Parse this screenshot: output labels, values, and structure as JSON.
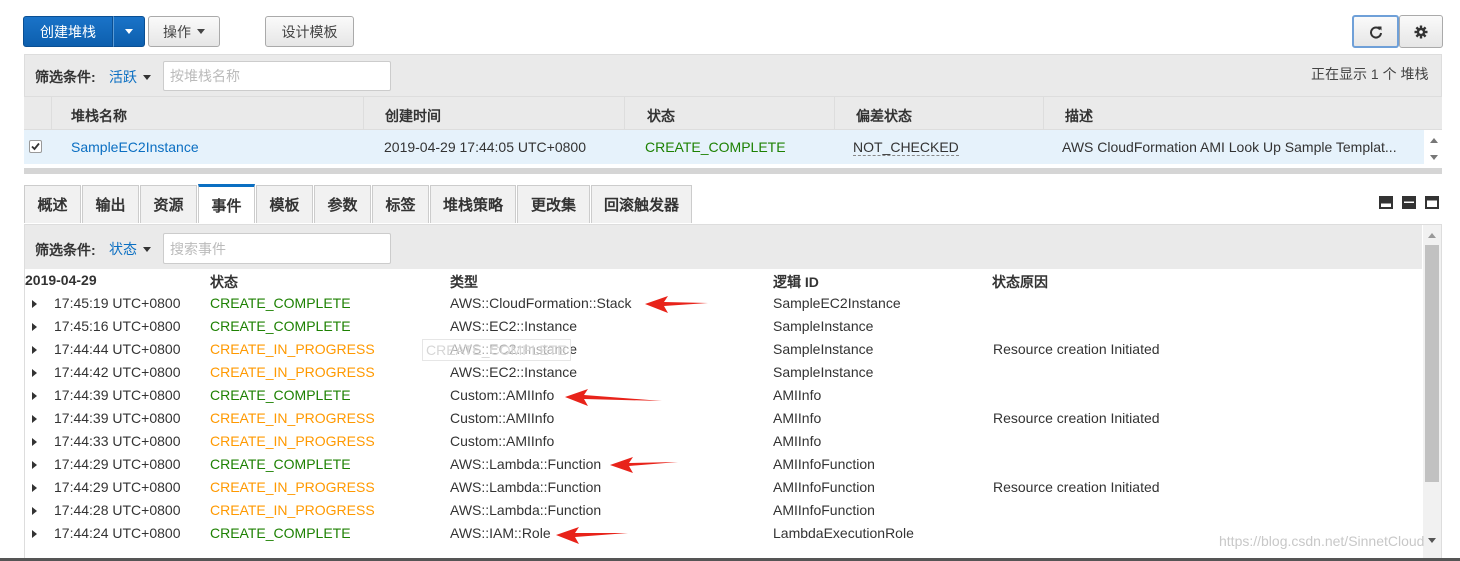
{
  "toolbar": {
    "create_stack": "创建堆栈",
    "actions": "操作",
    "design_template": "设计模板"
  },
  "stack_filter": {
    "label": "筛选条件:",
    "value": "活跃",
    "placeholder": "按堆栈名称",
    "showing": "正在显示 1 个 堆栈"
  },
  "stack_table": {
    "columns": [
      "堆栈名称",
      "创建时间",
      "状态",
      "偏差状态",
      "描述"
    ],
    "row": {
      "name": "SampleEC2Instance",
      "created": "2019-04-29 17:44:05 UTC+0800",
      "status": "CREATE_COMPLETE",
      "drift": "NOT_CHECKED",
      "description": "AWS CloudFormation AMI Look Up Sample Templat..."
    }
  },
  "tabs": [
    "概述",
    "输出",
    "资源",
    "事件",
    "模板",
    "参数",
    "标签",
    "堆栈策略",
    "更改集",
    "回滚触发器"
  ],
  "active_tab": "事件",
  "event_filter": {
    "label": "筛选条件:",
    "value": "状态",
    "placeholder": "搜索事件"
  },
  "events_table": {
    "date": "2019-04-29",
    "columns": [
      "状态",
      "类型",
      "逻辑 ID",
      "状态原因"
    ],
    "rows": [
      {
        "time": "17:45:19 UTC+0800",
        "status": "CREATE_COMPLETE",
        "type": "AWS::CloudFormation::Stack",
        "logical_id": "SampleEC2Instance",
        "reason": ""
      },
      {
        "time": "17:45:16 UTC+0800",
        "status": "CREATE_COMPLETE",
        "type": "AWS::EC2::Instance",
        "logical_id": "SampleInstance",
        "reason": ""
      },
      {
        "time": "17:44:44 UTC+0800",
        "status": "CREATE_IN_PROGRESS",
        "type": "AWS::EC2::Instance",
        "logical_id": "SampleInstance",
        "reason": "Resource creation Initiated"
      },
      {
        "time": "17:44:42 UTC+0800",
        "status": "CREATE_IN_PROGRESS",
        "type": "AWS::EC2::Instance",
        "logical_id": "SampleInstance",
        "reason": ""
      },
      {
        "time": "17:44:39 UTC+0800",
        "status": "CREATE_COMPLETE",
        "type": "Custom::AMIInfo",
        "logical_id": "AMIInfo",
        "reason": ""
      },
      {
        "time": "17:44:39 UTC+0800",
        "status": "CREATE_IN_PROGRESS",
        "type": "Custom::AMIInfo",
        "logical_id": "AMIInfo",
        "reason": "Resource creation Initiated"
      },
      {
        "time": "17:44:33 UTC+0800",
        "status": "CREATE_IN_PROGRESS",
        "type": "Custom::AMIInfo",
        "logical_id": "AMIInfo",
        "reason": ""
      },
      {
        "time": "17:44:29 UTC+0800",
        "status": "CREATE_COMPLETE",
        "type": "AWS::Lambda::Function",
        "logical_id": "AMIInfoFunction",
        "reason": ""
      },
      {
        "time": "17:44:29 UTC+0800",
        "status": "CREATE_IN_PROGRESS",
        "type": "AWS::Lambda::Function",
        "logical_id": "AMIInfoFunction",
        "reason": "Resource creation Initiated"
      },
      {
        "time": "17:44:28 UTC+0800",
        "status": "CREATE_IN_PROGRESS",
        "type": "AWS::Lambda::Function",
        "logical_id": "AMIInfoFunction",
        "reason": ""
      },
      {
        "time": "17:44:24 UTC+0800",
        "status": "CREATE_COMPLETE",
        "type": "AWS::IAM::Role",
        "logical_id": "LambdaExecutionRole",
        "reason": ""
      }
    ]
  },
  "tooltip_ghost": "CREATE_COMPLETE",
  "watermark": "https://blog.csdn.net/SinnetCloud",
  "colors": {
    "complete": "#1d8102",
    "in_progress": "#ff9900",
    "link": "#0b6fc2",
    "annotation_arrow": "#e8231a"
  },
  "icons": [
    "caret-down-icon",
    "refresh-icon",
    "gear-icon",
    "checkbox-checked-icon",
    "expand-row-icon",
    "layout-icons",
    "annotation-arrow"
  ]
}
